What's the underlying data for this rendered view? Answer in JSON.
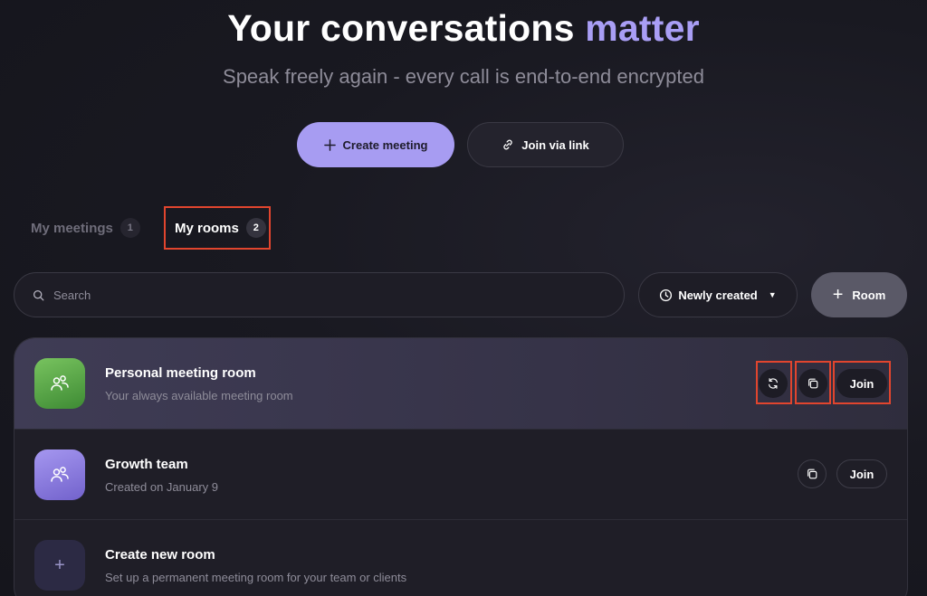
{
  "hero": {
    "title_main": "Your conversations",
    "title_accent": "matter",
    "subtitle": "Speak freely again - every call is end-to-end encrypted"
  },
  "actions": {
    "create_meeting": "Create meeting",
    "join_via_link": "Join via link"
  },
  "tabs": [
    {
      "label": "My meetings",
      "count": "1",
      "selected": false
    },
    {
      "label": "My rooms",
      "count": "2",
      "selected": true
    }
  ],
  "toolbar": {
    "search_placeholder": "Search",
    "sort_label": "Newly created",
    "add_room_label": "Room"
  },
  "rooms": [
    {
      "title": "Personal meeting room",
      "description": "Your always available meeting room",
      "join_label": "Join",
      "icon": "people-icon",
      "color": "#5aa64a"
    },
    {
      "title": "Growth team",
      "description": "Created on January 9",
      "join_label": "Join",
      "icon": "people-icon",
      "color": "#8b7ce0"
    },
    {
      "title": "Create new room",
      "description": "Set up a permanent meeting room for your team or clients",
      "icon": "plus-icon"
    }
  ],
  "colors": {
    "accent": "#a99ef5",
    "primary_button": "#a79cf2",
    "highlight": "#e1452e",
    "background": "#17171f"
  }
}
